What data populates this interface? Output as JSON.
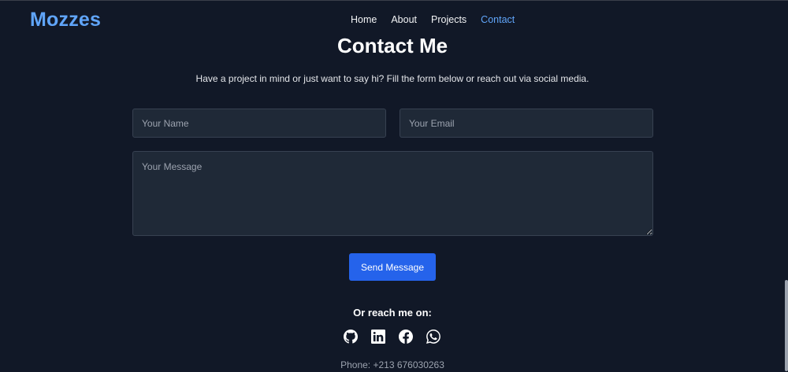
{
  "brand": {
    "name": "Mozzes",
    "color": "#60a5fa"
  },
  "nav": {
    "items": [
      {
        "label": "Home",
        "active": false
      },
      {
        "label": "About",
        "active": false
      },
      {
        "label": "Projects",
        "active": false
      },
      {
        "label": "Contact",
        "active": true
      }
    ]
  },
  "contact": {
    "title": "Contact Me",
    "subtitle": "Have a project in mind or just want to say hi? Fill the form below or reach out via social media.",
    "form": {
      "name_placeholder": "Your Name",
      "email_placeholder": "Your Email",
      "message_placeholder": "Your Message",
      "submit_label": "Send Message"
    },
    "reach_label": "Or reach me on:",
    "socials": [
      "github-icon",
      "linkedin-icon",
      "facebook-icon",
      "whatsapp-icon"
    ],
    "phone": "Phone: +213 676030263"
  },
  "colors": {
    "background": "#111827",
    "accent": "#2563eb",
    "field_bg": "#1f2937"
  }
}
